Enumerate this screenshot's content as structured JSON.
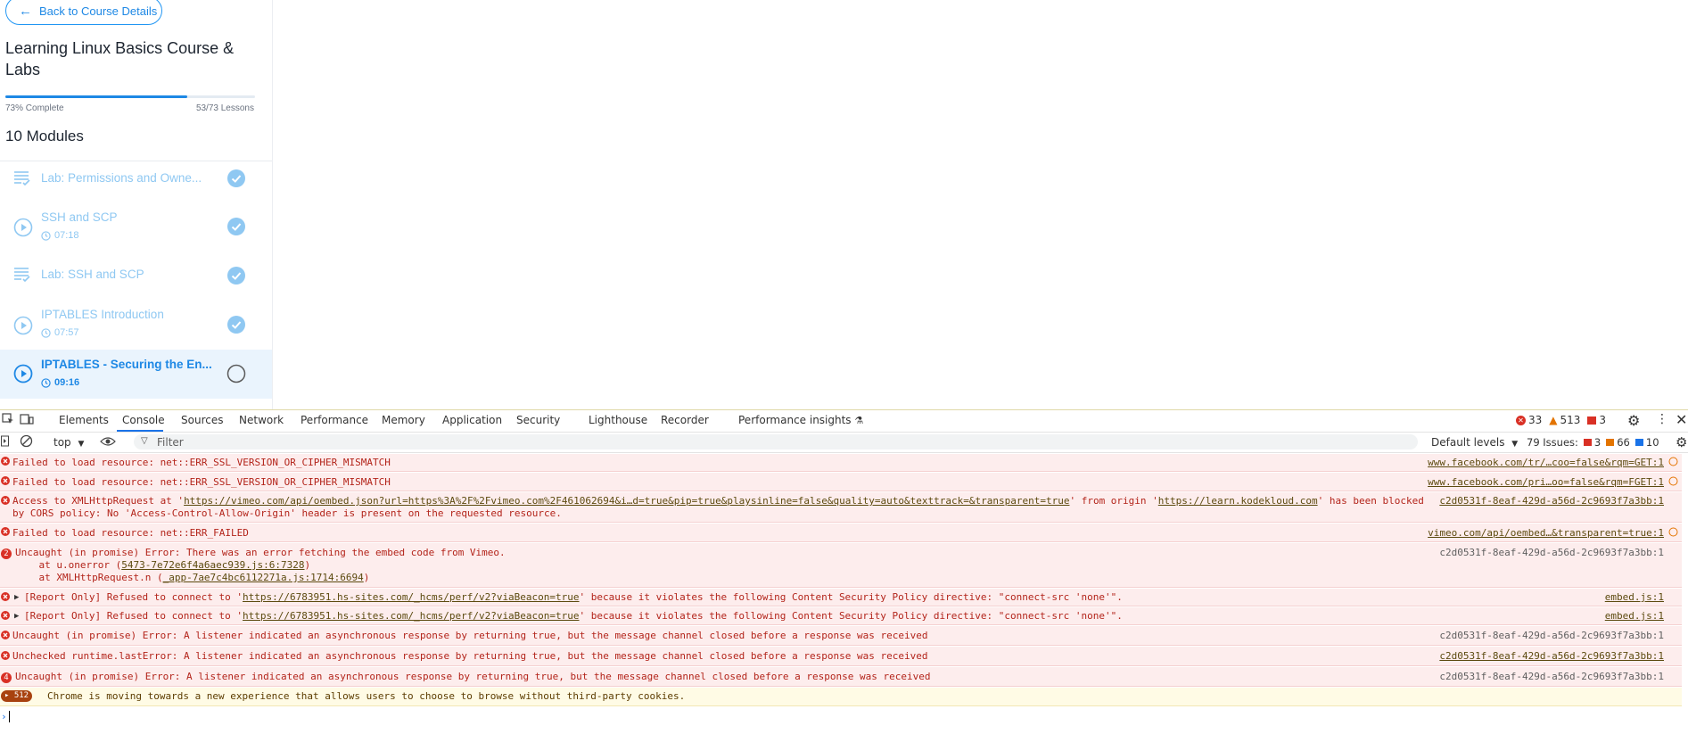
{
  "sidebar": {
    "back_label": "Back to Course Details",
    "course_title": "Learning Linux Basics Course & Labs",
    "progress_percent": 73,
    "progress_label": "73% Complete",
    "lessons_label": "53/73 Lessons",
    "modules_title": "10 Modules",
    "lessons": [
      {
        "title": "Lab: Permissions and Owne...",
        "time": "",
        "type": "lab",
        "done": true
      },
      {
        "title": "SSH and SCP",
        "time": "07:18",
        "type": "video",
        "done": true
      },
      {
        "title": "Lab: SSH and SCP",
        "time": "",
        "type": "lab",
        "done": true
      },
      {
        "title": "IPTABLES Introduction",
        "time": "07:57",
        "type": "video",
        "done": true
      },
      {
        "title": "IPTABLES - Securing the En...",
        "time": "09:16",
        "type": "video",
        "done": false
      }
    ]
  },
  "devtools": {
    "tabs": [
      "Elements",
      "Console",
      "Sources",
      "Network",
      "Performance",
      "Memory",
      "Application",
      "Security",
      "Lighthouse",
      "Recorder",
      "Performance insights"
    ],
    "active_tab": "Console",
    "errors_count": "33",
    "warnings_count": "513",
    "info_count": "3",
    "context": "top",
    "filter_placeholder": "Filter",
    "levels": "Default levels",
    "issues_label": "79 Issues:",
    "issues_errors": "3",
    "issues_warnings": "66",
    "issues_info": "10",
    "messages": [
      {
        "text": "Failed to load resource: net::ERR_SSL_VERSION_OR_CIPHER_MISMATCH",
        "source": "www.facebook.com/tr/…coo=false&rqm=GET:1"
      },
      {
        "text": "Failed to load resource: net::ERR_SSL_VERSION_OR_CIPHER_MISMATCH",
        "source": "www.facebook.com/pri…oo=false&rqm=FGET:1"
      },
      {
        "text_pre": "Access to XMLHttpRequest at '",
        "link1": "https://vimeo.com/api/oembed.json?url=https%3A%2F%2Fvimeo.com%2F461062694&i…d=true&pip=true&playsinline=false&quality=auto&texttrack=&transparent=true",
        "text_mid": "' from origin '",
        "link2": "https://learn.kodekloud.com",
        "text_post": "' has been blocked",
        "line2": "by CORS policy: No 'Access-Control-Allow-Origin' header is present on the requested resource.",
        "source": "c2d0531f-8eaf-429d-a56d-2c9693f7a3bb:1"
      },
      {
        "text": "Failed to load resource: net::ERR_FAILED",
        "source": "vimeo.com/api/oembed…&transparent=true:1"
      },
      {
        "count": "2",
        "text": "Uncaught (in promise) Error: There was an error fetching the embed code from Vimeo.",
        "line2_pre": "    at u.onerror (",
        "line2_link": "5473-7e72e6f4a6aec939.js:6:7328",
        "line2_post": ")",
        "line3_pre": "    at XMLHttpRequest.n (",
        "line3_link": "_app-7ae7c4bc6112271a.js:1714:6694",
        "line3_post": ")",
        "source": "c2d0531f-8eaf-429d-a56d-2c9693f7a3bb:1"
      },
      {
        "text_pre": "[Report Only] Refused to connect to '",
        "link1": "https://6783951.hs-sites.com/_hcms/perf/v2?viaBeacon=true",
        "text_post": "' because it violates the following Content Security Policy directive: \"connect-src 'none'\".",
        "source": "embed.js:1"
      },
      {
        "text_pre": "[Report Only] Refused to connect to '",
        "link1": "https://6783951.hs-sites.com/_hcms/perf/v2?viaBeacon=true",
        "text_post": "' because it violates the following Content Security Policy directive: \"connect-src 'none'\".",
        "source": "embed.js:1"
      },
      {
        "text": "Uncaught (in promise) Error: A listener indicated an asynchronous response by returning true, but the message channel closed before a response was received",
        "source": "c2d0531f-8eaf-429d-a56d-2c9693f7a3bb:1"
      },
      {
        "text": "Unchecked runtime.lastError: A listener indicated an asynchronous response by returning true, but the message channel closed before a response was received",
        "source": "c2d0531f-8eaf-429d-a56d-2c9693f7a3bb:1"
      },
      {
        "count": "4",
        "text": "Uncaught (in promise) Error: A listener indicated an asynchronous response by returning true, but the message channel closed before a response was received",
        "source": "c2d0531f-8eaf-429d-a56d-2c9693f7a3bb:1"
      },
      {
        "count": "512",
        "text": "Chrome is moving towards a new experience that allows users to choose to browse without third-party cookies."
      }
    ]
  }
}
